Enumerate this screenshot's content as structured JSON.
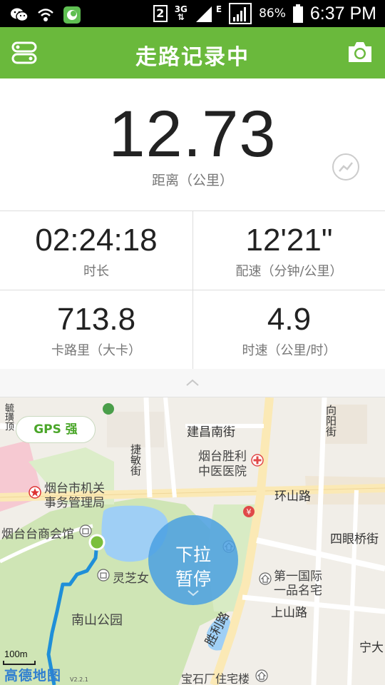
{
  "status_bar": {
    "sim_badge": "2",
    "network_type": "3G",
    "network_type_2": "E",
    "battery_percent": "86%",
    "time": "6:37 PM",
    "icons": [
      "wechat-icon",
      "wifi-icon",
      "app-notification-icon",
      "signal-icon",
      "battery-icon"
    ]
  },
  "header": {
    "title": "走路记录中",
    "left_icon": "menu-icon",
    "right_icon": "camera-icon",
    "accent_color": "#6ab93c"
  },
  "distance": {
    "value": "12.73",
    "label": "距离（公里）"
  },
  "stats": [
    {
      "value": "02:24:18",
      "label": "时长"
    },
    {
      "value": "12'21\"",
      "label": "配速（分钟/公里）"
    },
    {
      "value": "713.8",
      "label": "卡路里（大卡）"
    },
    {
      "value": "4.9",
      "label": "时速（公里/时）"
    }
  ],
  "map": {
    "gps_status": "GPS 强",
    "pause_button": {
      "line1": "下拉",
      "line2": "暂停"
    },
    "scale": "100m",
    "brand": "高德地图",
    "brand_version": "V2.2.1",
    "labels": {
      "jianchang": "建昌南街",
      "hospital_1": "烟台胜利",
      "hospital_2": "中医医院",
      "jiemin": "捷敏街",
      "office_1": "烟台市机关",
      "office_2": "事务管理局",
      "huanshan": "环山路",
      "chamber": "烟台台商会馆",
      "simian": "四眼桥街",
      "lingzhi": "灵芝女",
      "guoji_1": "第一国际",
      "guoji_2": "一品名宅",
      "nanshan": "南山公园",
      "shangshan": "上山路",
      "shengli": "胜利路",
      "ningda": "宁大",
      "baoshi": "宝石厂住宅楼",
      "xiangyang": "向阳街",
      "left_road": "毓璜顶"
    }
  }
}
